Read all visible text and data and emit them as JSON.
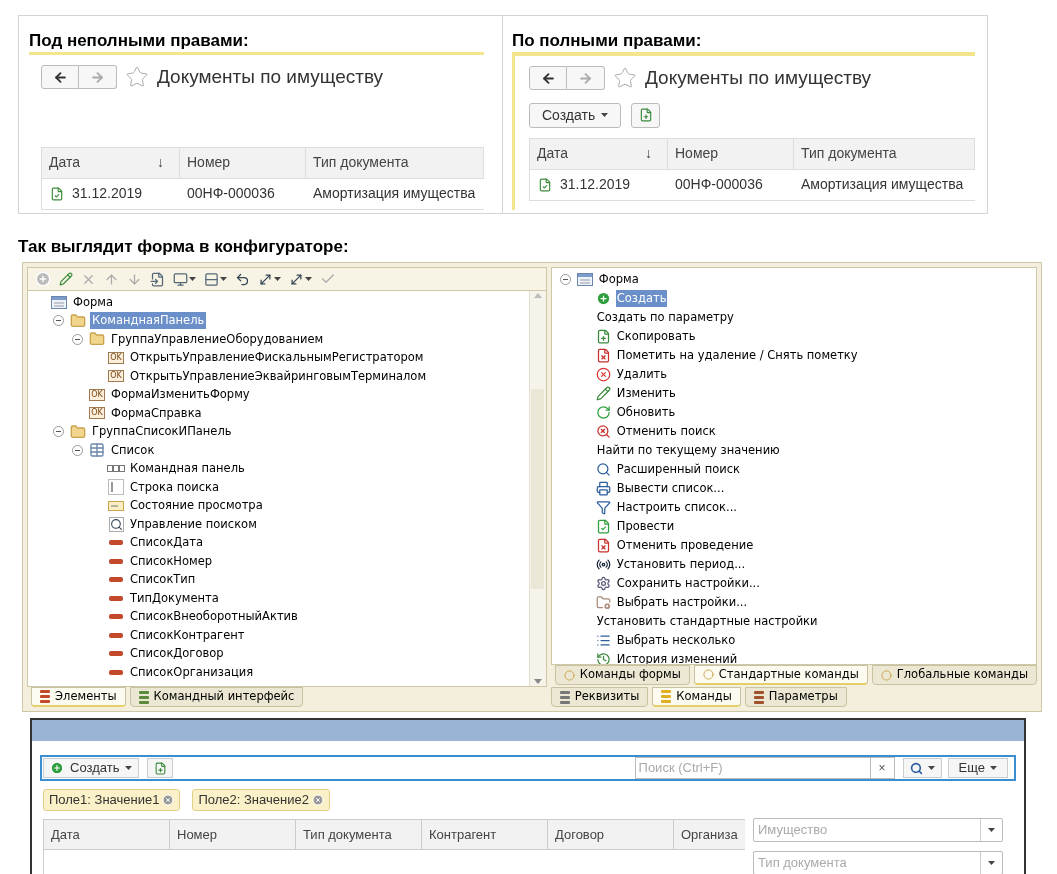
{
  "comparison": [
    {
      "kind": "limited",
      "heading": "Под неполными правами:",
      "title": "Документы по имуществу",
      "columns": [
        {
          "label": "Дата",
          "sort_mark": "↓"
        },
        {
          "label": "Номер"
        },
        {
          "label": "Тип документа"
        }
      ],
      "rows": [
        {
          "cells": [
            "31.12.2019",
            "00НФ-000036",
            "Амортизация имущества"
          ]
        }
      ]
    },
    {
      "kind": "full",
      "heading": "По полными правами:",
      "title": "Документы по имуществу",
      "create_button": "Создать",
      "columns": [
        {
          "label": "Дата",
          "sort_mark": "↓"
        },
        {
          "label": "Номер"
        },
        {
          "label": "Тип документа"
        }
      ],
      "rows": [
        {
          "cells": [
            "31.12.2019",
            "00НФ-000036",
            "Амортизация имущества"
          ]
        }
      ]
    }
  ],
  "configurator_heading": "Так выглядит форма в конфигураторе:",
  "elements_panel": {
    "tree": [
      {
        "label": "Форма",
        "kind": "form",
        "selected": false,
        "children": [
          {
            "label": "КоманднаяПанель",
            "kind": "folder",
            "selected": true,
            "expanded": true,
            "children": [
              {
                "label": "ГруппаУправлениеОборудованием",
                "kind": "folder",
                "selected": false,
                "expanded": true,
                "children": [
                  {
                    "label": "ОткрытьУправлениеФискальнымРегистратором",
                    "kind": "button",
                    "icon_text": "OK",
                    "selected": false
                  },
                  {
                    "label": "ОткрытьУправлениеЭквайринговымТерминалом",
                    "kind": "button",
                    "icon_text": "OK",
                    "selected": false
                  }
                ]
              },
              {
                "label": "ФормаИзменитьФорму",
                "kind": "button",
                "icon_text": "OK",
                "selected": false
              },
              {
                "label": "ФормаСправка",
                "kind": "button",
                "icon_text": "OK",
                "selected": false
              }
            ]
          },
          {
            "label": "ГруппаСписокИПанель",
            "kind": "folder",
            "selected": false,
            "expanded": true,
            "children": [
              {
                "label": "Список",
                "kind": "table",
                "selected": false,
                "expanded": true,
                "children": [
                  {
                    "label": "Командная панель",
                    "kind": "command-bar",
                    "selected": false
                  },
                  {
                    "label": "Строка поиска",
                    "kind": "search-string",
                    "selected": false
                  },
                  {
                    "label": "Состояние просмотра",
                    "kind": "view-status",
                    "selected": false
                  },
                  {
                    "label": "Управление поиском",
                    "kind": "search-control",
                    "selected": false
                  },
                  {
                    "label": "СписокДата",
                    "kind": "field",
                    "selected": false
                  },
                  {
                    "label": "СписокНомер",
                    "kind": "field",
                    "selected": false
                  },
                  {
                    "label": "СписокТип",
                    "kind": "field",
                    "selected": false
                  },
                  {
                    "label": "ТипДокумента",
                    "kind": "field",
                    "selected": false
                  },
                  {
                    "label": "СписокВнеоборотныйАктив",
                    "kind": "field",
                    "selected": false
                  },
                  {
                    "label": "СписокКонтрагент",
                    "kind": "field",
                    "selected": false
                  },
                  {
                    "label": "СписокДоговор",
                    "kind": "field",
                    "selected": false
                  },
                  {
                    "label": "СписокОрганизация",
                    "kind": "field",
                    "selected": false
                  }
                ]
              }
            ]
          }
        ]
      }
    ],
    "tabs": [
      {
        "label": "Элементы",
        "selected": true
      },
      {
        "label": "Командный интерфейс",
        "selected": false
      }
    ]
  },
  "commands_panel": {
    "root": {
      "label": "Форма",
      "expanded": true
    },
    "items": [
      {
        "label": "Создать",
        "kind": "create",
        "selected": true
      },
      {
        "label": "Создать по параметру",
        "kind": "none",
        "selected": false
      },
      {
        "label": "Скопировать",
        "kind": "copy",
        "selected": false
      },
      {
        "label": "Пометить на удаление / Снять пометку",
        "kind": "mark-delete",
        "selected": false
      },
      {
        "label": "Удалить",
        "kind": "delete",
        "selected": false
      },
      {
        "label": "Изменить",
        "kind": "edit",
        "selected": false
      },
      {
        "label": "Обновить",
        "kind": "refresh",
        "selected": false
      },
      {
        "label": "Отменить поиск",
        "kind": "cancel-search",
        "selected": false
      },
      {
        "label": "Найти по текущему значению",
        "kind": "none",
        "selected": false
      },
      {
        "label": "Расширенный поиск",
        "kind": "search",
        "selected": false
      },
      {
        "label": "Вывести список...",
        "kind": "print",
        "selected": false
      },
      {
        "label": "Настроить список...",
        "kind": "filter",
        "selected": false
      },
      {
        "label": "Провести",
        "kind": "post",
        "selected": false
      },
      {
        "label": "Отменить проведение",
        "kind": "unpost",
        "selected": false
      },
      {
        "label": "Установить период...",
        "kind": "period",
        "selected": false
      },
      {
        "label": "Сохранить настройки...",
        "kind": "save-settings",
        "selected": false
      },
      {
        "label": "Выбрать настройки...",
        "kind": "load-settings",
        "selected": false
      },
      {
        "label": "Установить стандартные настройки",
        "kind": "none",
        "selected": false
      },
      {
        "label": "Выбрать несколько",
        "kind": "list",
        "selected": false
      },
      {
        "label": "История изменений",
        "kind": "history",
        "selected": false
      }
    ],
    "upper_tabs": [
      {
        "label": "Команды формы",
        "selected": false
      },
      {
        "label": "Стандартные команды",
        "selected": true
      },
      {
        "label": "Глобальные команды",
        "selected": false
      }
    ],
    "lower_tabs": [
      {
        "label": "Реквизиты",
        "selected": false
      },
      {
        "label": "Команды",
        "selected": true
      },
      {
        "label": "Параметры",
        "selected": false
      }
    ]
  },
  "form_preview": {
    "create_button": "Создать",
    "search": {
      "placeholder": "Поиск (Ctrl+F)"
    },
    "clear_button": "×",
    "more_button": "Еще",
    "filters": [
      "Поле1: Значение1",
      "Поле2: Значение2"
    ],
    "columns": [
      "Дата",
      "Номер",
      "Тип документа",
      "Контрагент",
      "Договор",
      "Организа"
    ],
    "side_fields": [
      {
        "placeholder": "Имущество"
      },
      {
        "placeholder": "Тип документа"
      }
    ]
  }
}
